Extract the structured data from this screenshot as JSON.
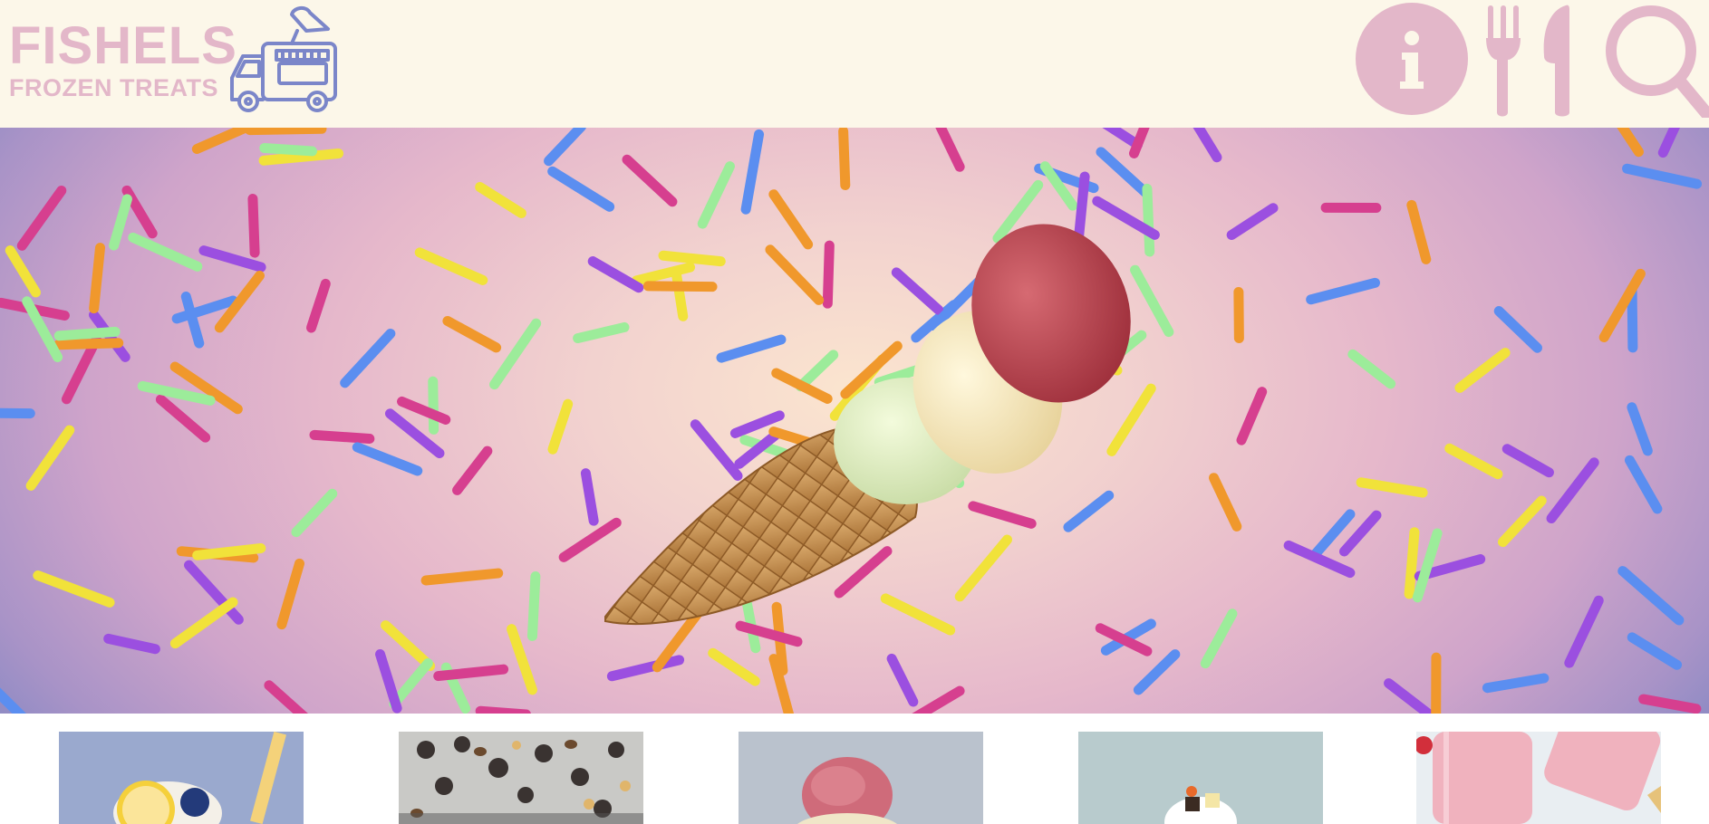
{
  "brand": {
    "title": "FISHELS",
    "subtitle": "FROZEN TREATS",
    "logo_color": "#e3b7c9",
    "truck_color": "#7b86c9",
    "truck_icon": "ice-cream-truck-icon"
  },
  "nav": {
    "icons": [
      "info-icon",
      "fork-knife-icon",
      "search-icon"
    ],
    "icon_color": "#e3b7c9"
  },
  "header_bg": "#fcf7e9",
  "hero": {
    "image": "ice-cream-cone-with-three-scoops",
    "background": "sprinkles-on-pink-purple-gradient",
    "sprinkle_colors": [
      "#f0982c",
      "#9b4fe0",
      "#d63f8f",
      "#5b8ef0",
      "#9cec9a",
      "#f1e23a"
    ]
  },
  "thumbnails": [
    {
      "image": "lemon-blueberry-drink-thumbnail"
    },
    {
      "image": "chocolate-chips-thumbnail"
    },
    {
      "image": "pink-ice-cream-scoop-thumbnail"
    },
    {
      "image": "chocolate-sundae-thumbnail"
    },
    {
      "image": "strawberry-popsicles-thumbnail"
    }
  ]
}
